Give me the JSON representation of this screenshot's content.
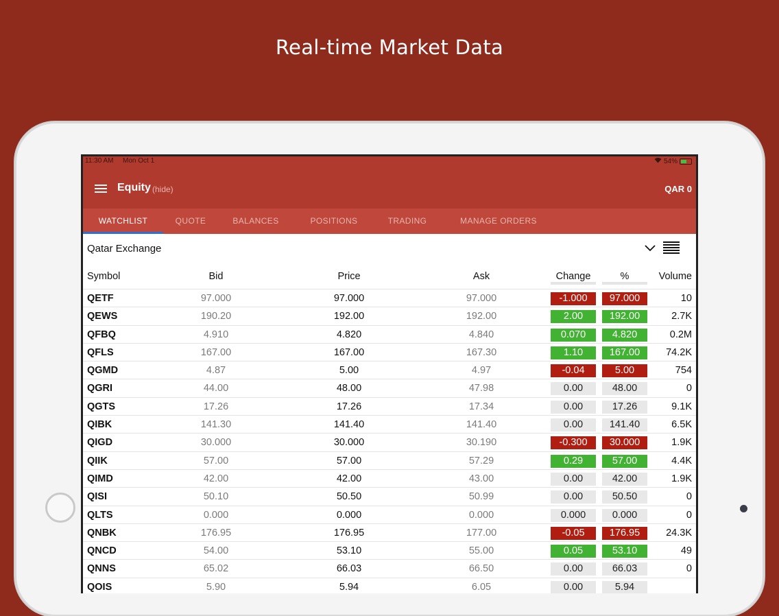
{
  "promo_title": "Real-time Market Data",
  "status_bar": {
    "time": "11:30 AM",
    "date": "Mon Oct 1",
    "battery": "54%"
  },
  "header": {
    "title": "Equity",
    "hide_label": "(hide)",
    "currency": "QAR 0"
  },
  "tabs": [
    {
      "label": "WATCHLIST",
      "active": true
    },
    {
      "label": "QUOTE"
    },
    {
      "label": "BALANCES"
    },
    {
      "label": "POSITIONS"
    },
    {
      "label": "TRADING"
    },
    {
      "label": "MANAGE ORDERS"
    }
  ],
  "exchange": "Qatar Exchange",
  "columns": [
    "Symbol",
    "Bid",
    "Price",
    "Ask",
    "Change",
    "%",
    "Volume"
  ],
  "rows": [
    {
      "symbol": "QETF",
      "bid": "97.000",
      "price": "97.000",
      "ask": "97.000",
      "change": "-1.000",
      "pct": "97.000",
      "volume": "10",
      "dir": "down"
    },
    {
      "symbol": "QEWS",
      "bid": "190.20",
      "price": "192.00",
      "ask": "192.00",
      "change": "2.00",
      "pct": "192.00",
      "volume": "2.7K",
      "dir": "up"
    },
    {
      "symbol": "QFBQ",
      "bid": "4.910",
      "price": "4.820",
      "ask": "4.840",
      "change": "0.070",
      "pct": "4.820",
      "volume": "0.2M",
      "dir": "up"
    },
    {
      "symbol": "QFLS",
      "bid": "167.00",
      "price": "167.00",
      "ask": "167.30",
      "change": "1.10",
      "pct": "167.00",
      "volume": "74.2K",
      "dir": "up"
    },
    {
      "symbol": "QGMD",
      "bid": "4.87",
      "price": "5.00",
      "ask": "4.97",
      "change": "-0.04",
      "pct": "5.00",
      "volume": "754",
      "dir": "down"
    },
    {
      "symbol": "QGRI",
      "bid": "44.00",
      "price": "48.00",
      "ask": "47.98",
      "change": "0.00",
      "pct": "48.00",
      "volume": "0",
      "dir": "neutral"
    },
    {
      "symbol": "QGTS",
      "bid": "17.26",
      "price": "17.26",
      "ask": "17.34",
      "change": "0.00",
      "pct": "17.26",
      "volume": "9.1K",
      "dir": "neutral"
    },
    {
      "symbol": "QIBK",
      "bid": "141.30",
      "price": "141.40",
      "ask": "141.40",
      "change": "0.00",
      "pct": "141.40",
      "volume": "6.5K",
      "dir": "neutral"
    },
    {
      "symbol": "QIGD",
      "bid": "30.000",
      "price": "30.000",
      "ask": "30.190",
      "change": "-0.300",
      "pct": "30.000",
      "volume": "1.9K",
      "dir": "down"
    },
    {
      "symbol": "QIIK",
      "bid": "57.00",
      "price": "57.00",
      "ask": "57.29",
      "change": "0.29",
      "pct": "57.00",
      "volume": "4.4K",
      "dir": "up"
    },
    {
      "symbol": "QIMD",
      "bid": "42.00",
      "price": "42.00",
      "ask": "43.00",
      "change": "0.00",
      "pct": "42.00",
      "volume": "1.9K",
      "dir": "neutral"
    },
    {
      "symbol": "QISI",
      "bid": "50.10",
      "price": "50.50",
      "ask": "50.99",
      "change": "0.00",
      "pct": "50.50",
      "volume": "0",
      "dir": "neutral"
    },
    {
      "symbol": "QLTS",
      "bid": "0.000",
      "price": "0.000",
      "ask": "0.000",
      "change": "0.000",
      "pct": "0.000",
      "volume": "0",
      "dir": "neutral"
    },
    {
      "symbol": "QNBK",
      "bid": "176.95",
      "price": "176.95",
      "ask": "177.00",
      "change": "-0.05",
      "pct": "176.95",
      "volume": "24.3K",
      "dir": "down"
    },
    {
      "symbol": "QNCD",
      "bid": "54.00",
      "price": "53.10",
      "ask": "55.00",
      "change": "0.05",
      "pct": "53.10",
      "volume": "49",
      "dir": "up"
    },
    {
      "symbol": "QNNS",
      "bid": "65.02",
      "price": "66.03",
      "ask": "66.50",
      "change": "0.00",
      "pct": "66.03",
      "volume": "0",
      "dir": "neutral"
    },
    {
      "symbol": "QOIS",
      "bid": "5.90",
      "price": "5.94",
      "ask": "6.05",
      "change": "0.00",
      "pct": "5.94",
      "volume": "",
      "dir": "neutral"
    }
  ],
  "colors": {
    "background": "#8e2b1c",
    "header": "#b03a2e",
    "tabs": "#c0473b",
    "up": "#41b232",
    "down": "#b01e12",
    "tab_indicator": "#2e6fd2"
  }
}
